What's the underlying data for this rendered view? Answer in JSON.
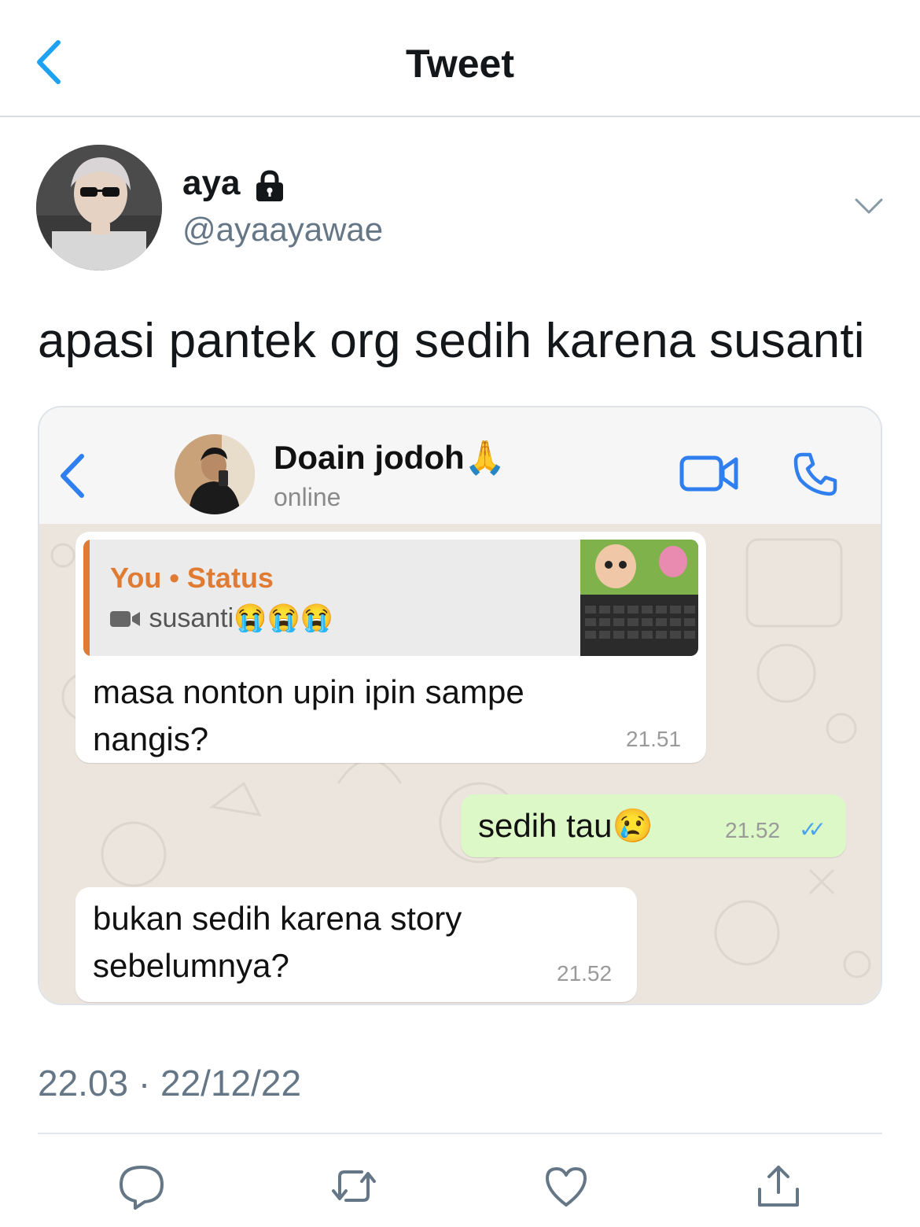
{
  "header": {
    "title": "Tweet"
  },
  "author": {
    "name": "aya",
    "handle": "@ayaayawae"
  },
  "tweet": {
    "text": "apasi pantek org sedih karena susanti",
    "timestamp": "22.03 · 22/12/22"
  },
  "icons": {
    "back": "chevron-left-icon",
    "lock": "lock-icon",
    "more": "chevron-down-icon",
    "reply": "reply-icon",
    "retweet": "retweet-icon",
    "like": "heart-icon",
    "share": "share-icon"
  },
  "colors": {
    "accent": "#1da1f2",
    "wa_blue": "#2f7ff0",
    "wa_quote": "#e07b33",
    "wa_out": "#dcf8c6"
  },
  "whatsapp": {
    "contact": {
      "name": "Doain jodoh",
      "emoji": "🙏",
      "status": "online"
    },
    "messages": [
      {
        "direction": "in",
        "quote": {
          "title": "You • Status",
          "text": "susanti",
          "emojis": "😭😭😭"
        },
        "text_line1": "masa nonton upin ipin sampe",
        "text_line2": "nangis?",
        "time": "21.51"
      },
      {
        "direction": "out",
        "text": "sedih tau",
        "emoji": "😢",
        "time": "21.52",
        "ticks": "✓✓"
      },
      {
        "direction": "in",
        "text_line1": "bukan sedih karena story",
        "text_line2": "sebelumnya?",
        "time": "21.52"
      }
    ]
  }
}
